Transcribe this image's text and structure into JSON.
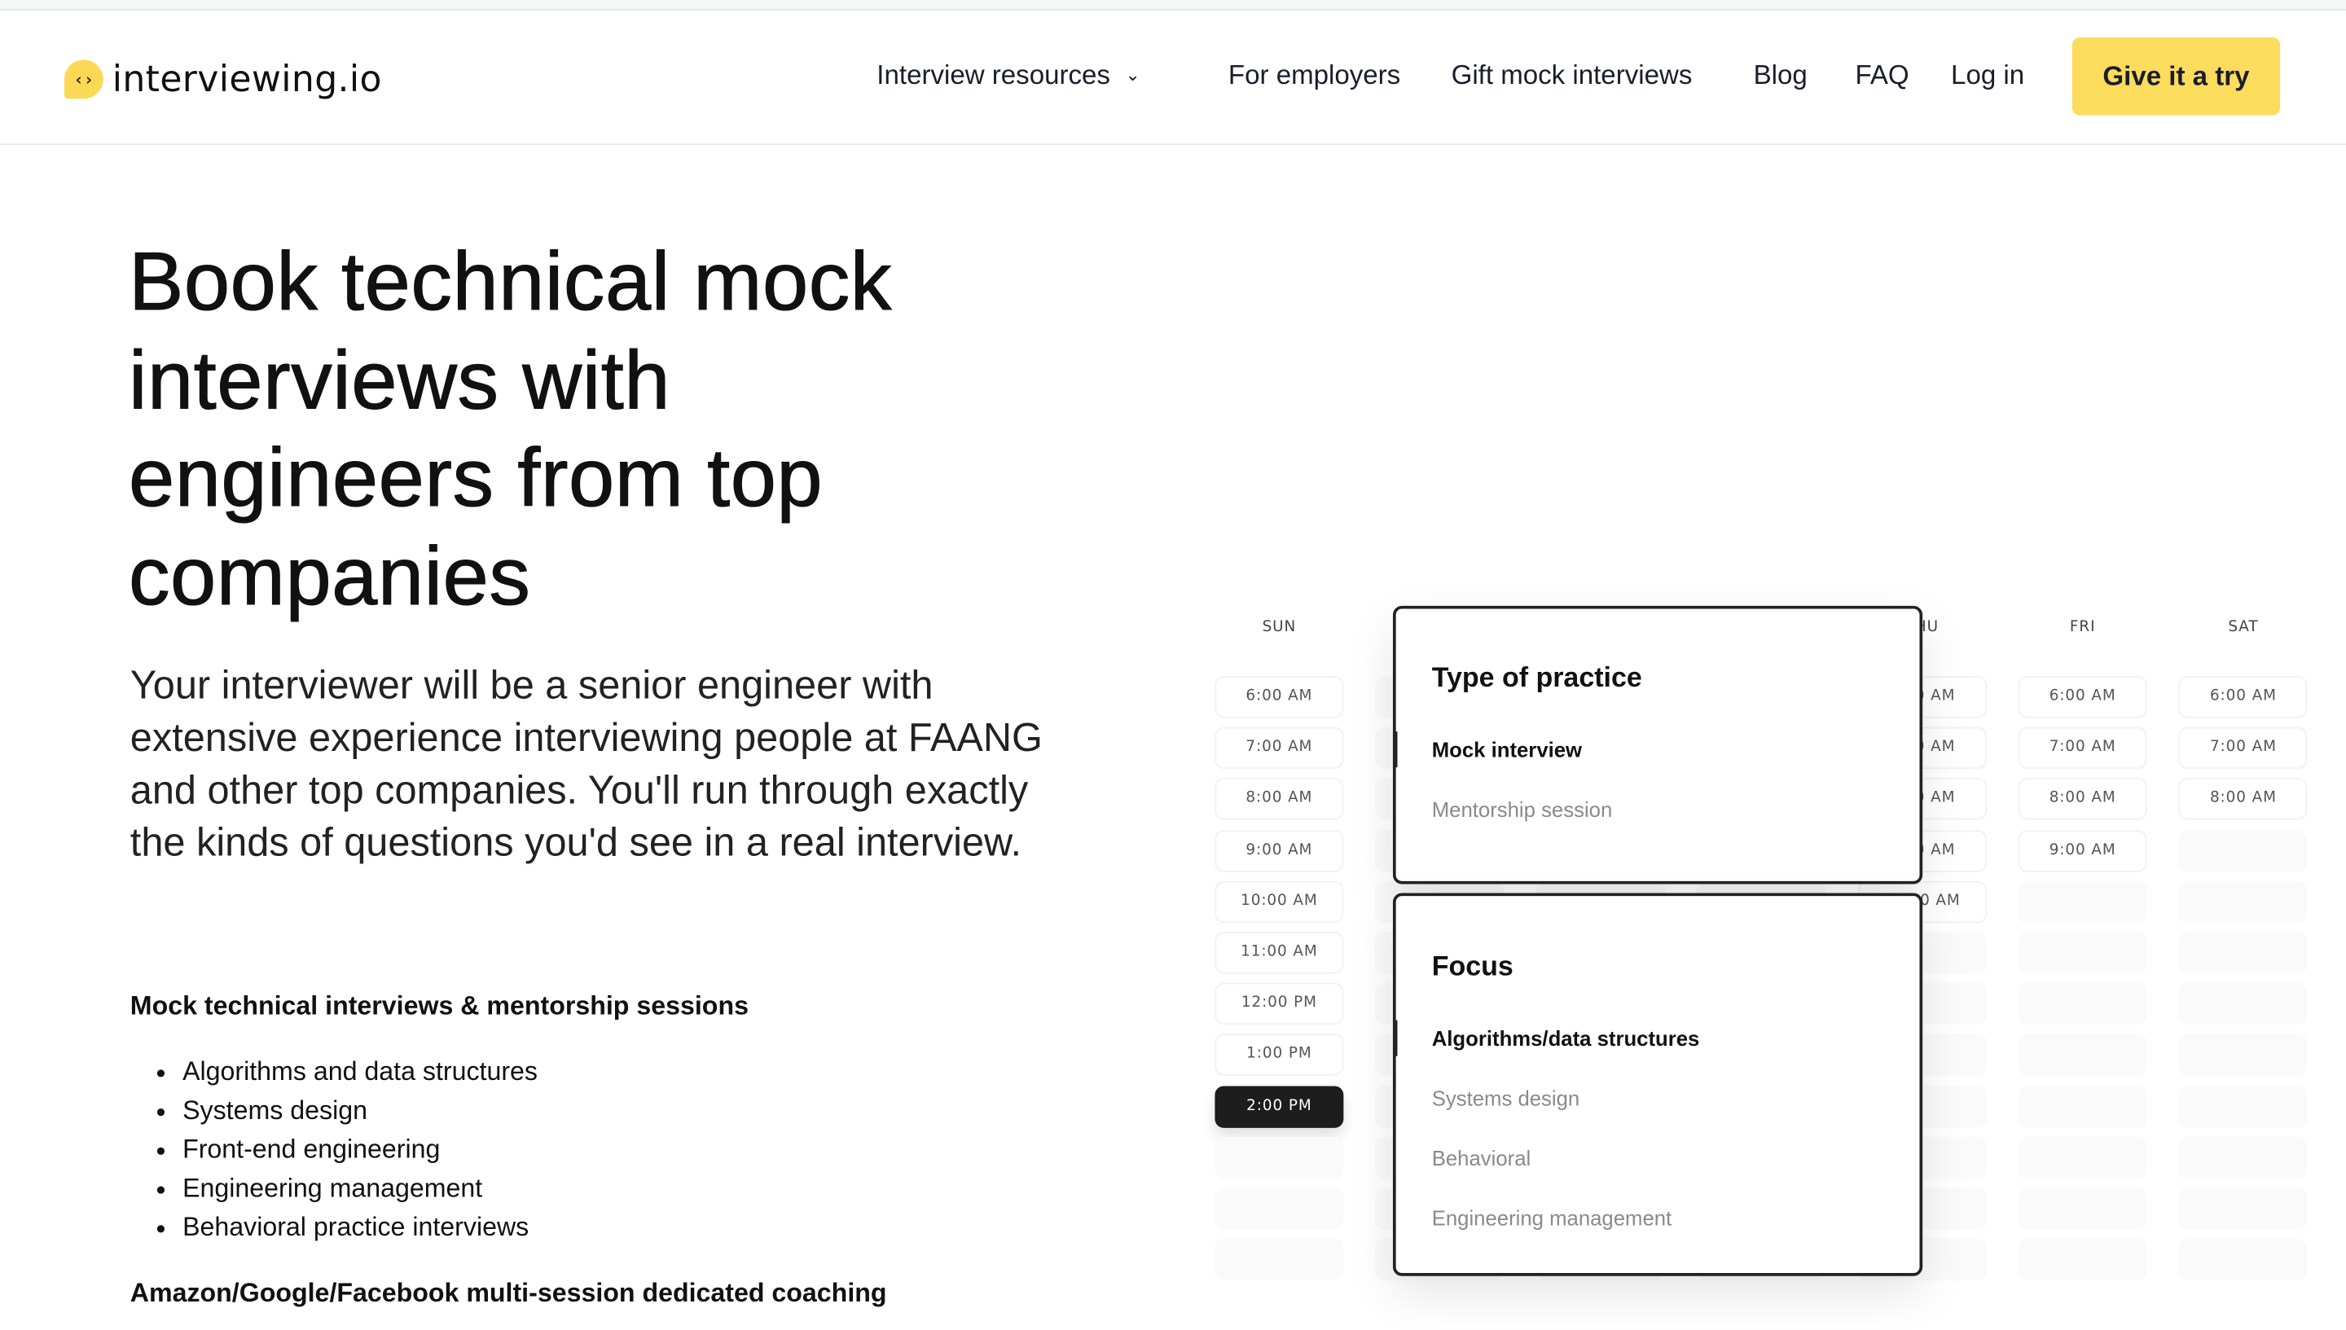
{
  "nav": {
    "logo_text": "interviewing.io",
    "logo_mark": "‹›",
    "items": [
      "Interview resources",
      "For employers",
      "Gift mock interviews",
      "Blog",
      "FAQ",
      "Log in"
    ],
    "dropdown_icon": "chevron-down-icon",
    "cta": "Give it a try",
    "cta_color": "#fcdc5c"
  },
  "hero": {
    "title": "Book technical mock interviews with engineers from top companies",
    "lead": "Your interviewer will be a senior engineer with extensive experience interviewing people at FAANG and other top companies. You'll run through exactly the kinds of questions you'd see in a real interview.",
    "section1_title": "Mock technical interviews & mentorship sessions",
    "section1_items": [
      "Algorithms and data structures",
      "Systems design",
      "Front-end engineering",
      "Engineering management",
      "Behavioral practice interviews"
    ],
    "section2_title": "Amazon/Google/Facebook multi-session dedicated coaching"
  },
  "calendar": {
    "days": [
      {
        "label": "SUN",
        "slots": [
          "6:00 AM",
          "7:00 AM",
          "8:00 AM",
          "9:00 AM",
          "10:00 AM",
          "11:00 AM",
          "12:00 PM",
          "1:00 PM",
          "2:00 PM",
          "",
          "",
          ""
        ],
        "selected": 8
      },
      {
        "label": "",
        "slots": [
          "",
          "",
          "",
          "",
          "",
          "",
          "",
          "",
          "",
          "",
          "",
          ""
        ]
      },
      {
        "label": "",
        "slots": [
          "",
          "",
          "",
          "",
          "",
          "",
          "",
          "",
          "",
          "",
          "",
          ""
        ]
      },
      {
        "label": "",
        "slots": [
          "",
          "",
          "",
          "",
          "",
          "",
          "",
          "",
          "",
          "",
          "",
          ""
        ]
      },
      {
        "label": "THU",
        "slots": [
          "6:00 AM",
          "7:00 AM",
          "8:00 AM",
          "9:00 AM",
          "10:00 AM",
          "",
          "",
          "",
          "",
          "",
          "",
          ""
        ]
      },
      {
        "label": "FRI",
        "slots": [
          "6:00 AM",
          "7:00 AM",
          "8:00 AM",
          "9:00 AM",
          "",
          "",
          "",
          "",
          "",
          "",
          "",
          ""
        ]
      },
      {
        "label": "SAT",
        "slots": [
          "6:00 AM",
          "7:00 AM",
          "8:00 AM",
          "",
          "",
          "",
          "",
          "",
          "",
          "",
          "",
          ""
        ]
      }
    ]
  },
  "practice": {
    "title": "Type of practice",
    "options": [
      "Mock interview",
      "Mentorship session"
    ],
    "selected": 0
  },
  "focus": {
    "title": "Focus",
    "options": [
      "Algorithms/data structures",
      "Systems design",
      "Behavioral",
      "Engineering management"
    ],
    "selected": 0
  }
}
